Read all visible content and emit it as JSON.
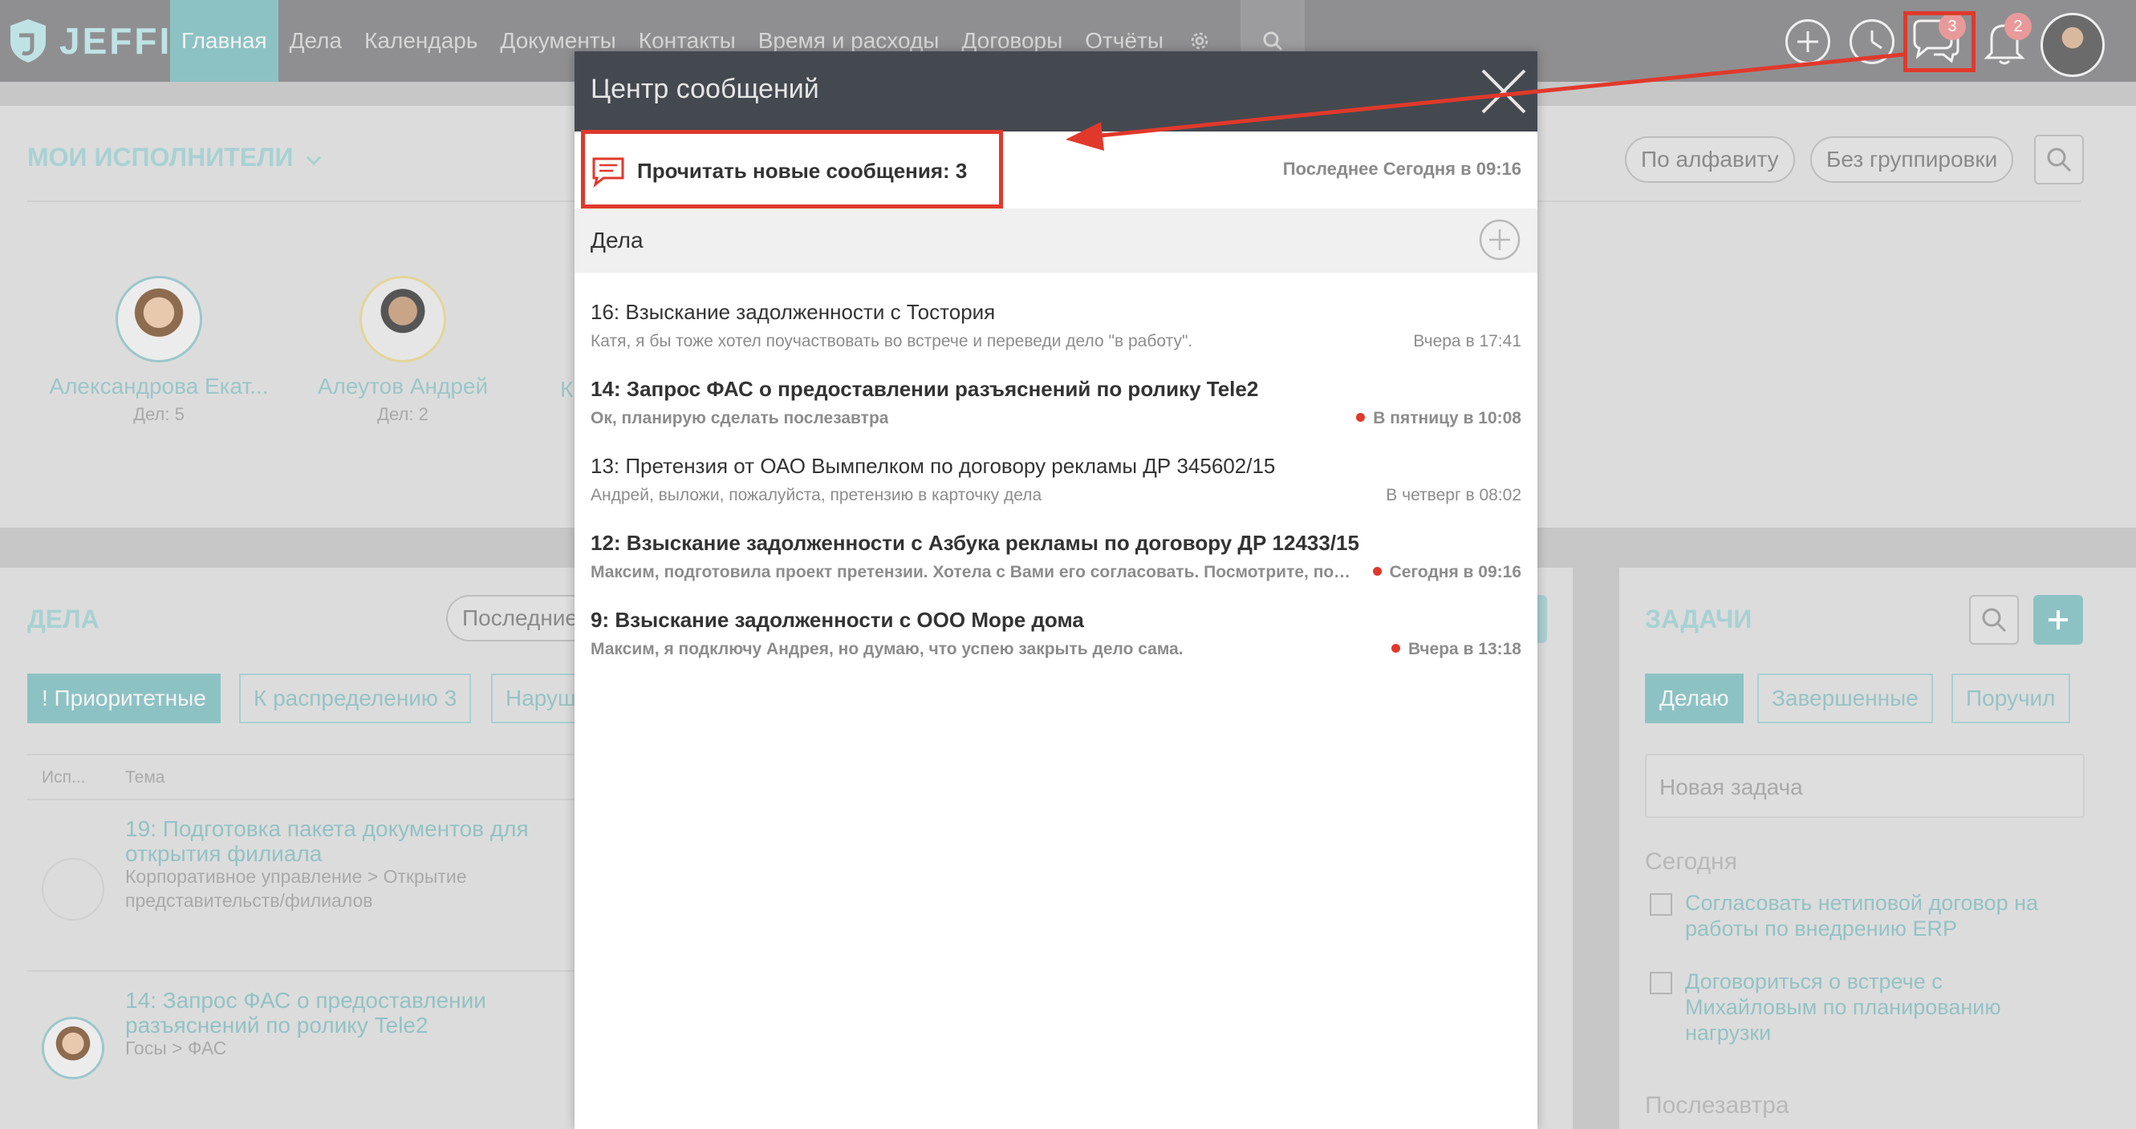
{
  "brand": {
    "logo_text": "JEFFIT"
  },
  "nav": {
    "items": [
      {
        "label": "Главная",
        "active": true
      },
      {
        "label": "Дела"
      },
      {
        "label": "Календарь"
      },
      {
        "label": "Документы"
      },
      {
        "label": "Контакты"
      },
      {
        "label": "Время и расходы"
      },
      {
        "label": "Договоры"
      },
      {
        "label": "Отчёты"
      }
    ]
  },
  "header_icons": {
    "messages_badge": "3",
    "notifications_badge": "2"
  },
  "performers": {
    "title": "МОИ ИСПОЛНИТЕЛИ",
    "sort_label": "По алфавиту",
    "group_label": "Без группировки",
    "items": [
      {
        "name": "Александрова Екат...",
        "count": "Дел: 5"
      },
      {
        "name": "Алеутов Андрей",
        "count": "Дел: 2"
      },
      {
        "name": "К"
      }
    ]
  },
  "cases": {
    "title": "ДЕЛА",
    "filter_placeholder": "Последние",
    "tabs": [
      {
        "label": "! Приоритетные"
      },
      {
        "label": "К распределению 3"
      },
      {
        "label": "Наруш"
      }
    ],
    "columns": [
      "Исп...",
      "Тема"
    ],
    "rows": [
      {
        "title": "19: Подготовка пакета документов для открытия филиала",
        "sub": "Корпоративное управление > Открытие представительств/филиалов"
      },
      {
        "title": "14: Запрос ФАС о предоставлении разъяснений по ролику Tele2",
        "sub": "Госы > ФАС"
      }
    ]
  },
  "tasks": {
    "title": "ЗАДАЧИ",
    "tabs": [
      "Делаю",
      "Завершенные",
      "Поручил"
    ],
    "new_placeholder": "Новая задача",
    "today_label": "Сегодня",
    "items": [
      "Согласовать нетиповой договор на работы по внедрению ERP",
      "Договориться о встрече с Михайловым по планированию нагрузки"
    ],
    "next_label": "Послезавтра"
  },
  "message_center": {
    "title": "Центр сообщений",
    "read_new": "Прочитать новые сообщения: 3",
    "last": "Последнее Сегодня в 09:16",
    "group": "Дела",
    "messages": [
      {
        "title": "16: Взыскание задолженности с Тостория",
        "preview": "Катя, я бы тоже хотел поучаствовать во встрече и переведи дело \"в работу\".",
        "time": "Вчера в 17:41",
        "unread": false
      },
      {
        "title": "14: Запрос ФАС о предоставлении разъяснений по ролику Tele2",
        "preview": "Ок, планирую сделать послезавтра",
        "time": "В пятницу в 10:08",
        "unread": true
      },
      {
        "title": "13: Претензия от ОАО Вымпелком по договору рекламы ДР 345602/15",
        "preview": "Андрей, выложи, пожалуйста, претензию в карточку дела",
        "time": "В четверг в 08:02",
        "unread": false
      },
      {
        "title": "12: Взыскание задолженности с Азбука рекламы по договору ДР 12433/15",
        "preview": "Максим, подготовила проект претензии. Хотела с Вами его согласовать. Посмотрите, пожалуйста",
        "time": "Сегодня в 09:16",
        "unread": true
      },
      {
        "title": "9: Взыскание задолженности с ООО Море дома",
        "preview": "Максим, я подключу Андрея, но думаю, что успею закрыть дело сама.",
        "time": "Вчера в 13:18",
        "unread": true
      }
    ]
  },
  "colors": {
    "accent": "#8dc2c4",
    "highlight": "#e0392b",
    "modal_header": "#444950"
  }
}
